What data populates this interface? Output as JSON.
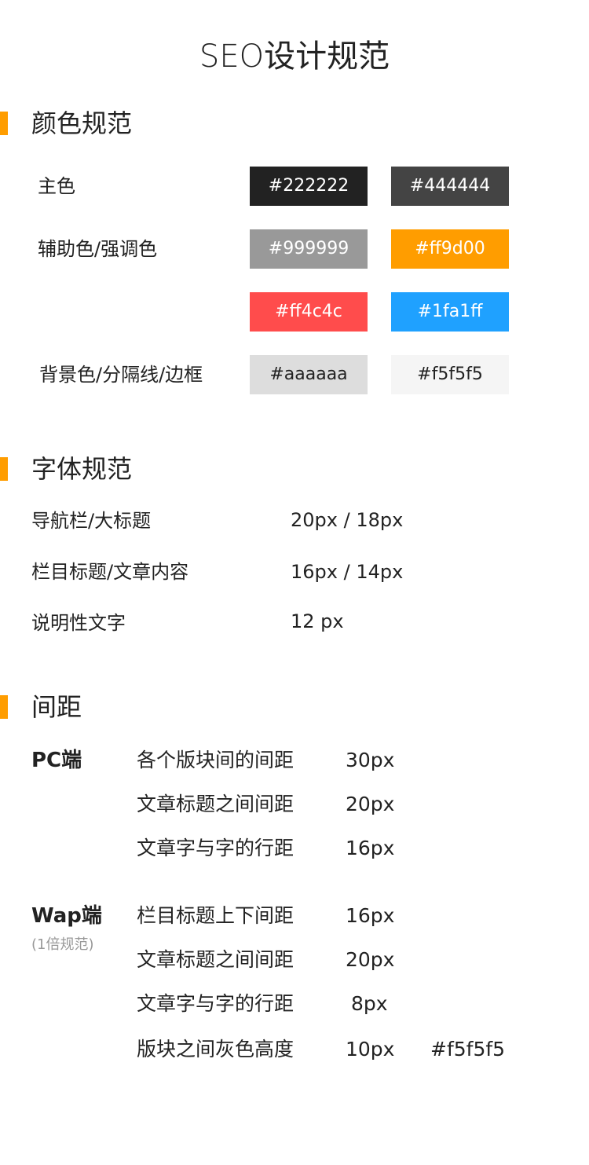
{
  "title": "SEO设计规范",
  "color_section": {
    "title": "颜色规范",
    "rows": {
      "primary_label": "主色",
      "secondary_label": "辅助色/强调色",
      "background_label": "背景色/分隔线/边框"
    },
    "swatches": [
      {
        "label": "#222222",
        "bg": "#222222",
        "fg": "#ffffff"
      },
      {
        "label": "#444444",
        "bg": "#444444",
        "fg": "#ffffff"
      },
      {
        "label": "#999999",
        "bg": "#999999",
        "fg": "#ffffff"
      },
      {
        "label": "#ff9d00",
        "bg": "#ff9d00",
        "fg": "#ffffff"
      },
      {
        "label": "#ff4c4c",
        "bg": "#ff4c4c",
        "fg": "#ffffff"
      },
      {
        "label": "#1fa1ff",
        "bg": "#1fa1ff",
        "fg": "#ffffff"
      },
      {
        "label": "#aaaaaa",
        "bg": "#dddddd",
        "fg": "#222222"
      },
      {
        "label": "#f5f5f5",
        "bg": "#f5f5f5",
        "fg": "#222222"
      }
    ]
  },
  "font_section": {
    "title": "字体规范",
    "rows": [
      {
        "label": "导航栏/大标题",
        "value": "20px / 18px"
      },
      {
        "label": "栏目标题/文章内容",
        "value": "16px / 14px"
      },
      {
        "label": "说明性文字",
        "value": "12 px"
      }
    ]
  },
  "spacing_section": {
    "title": "间距",
    "pc": {
      "platform": "PC端",
      "rows": [
        {
          "label": "各个版块间的间距",
          "value": "30px"
        },
        {
          "label": "文章标题之间间距",
          "value": "20px"
        },
        {
          "label": "文章字与字的行距",
          "value": "16px"
        }
      ]
    },
    "wap": {
      "platform": "Wap端",
      "note": "(1倍规范)",
      "rows": [
        {
          "label": "栏目标题上下间距",
          "value": "16px"
        },
        {
          "label": "文章标题之间间距",
          "value": "20px"
        },
        {
          "label": "文章字与字的行距",
          "value": "8px"
        },
        {
          "label": "版块之间灰色高度",
          "value": "10px",
          "extra": "#f5f5f5"
        }
      ]
    }
  },
  "colors": {
    "accent": "#ff9d00",
    "text": "#222222",
    "muted": "#999999"
  }
}
